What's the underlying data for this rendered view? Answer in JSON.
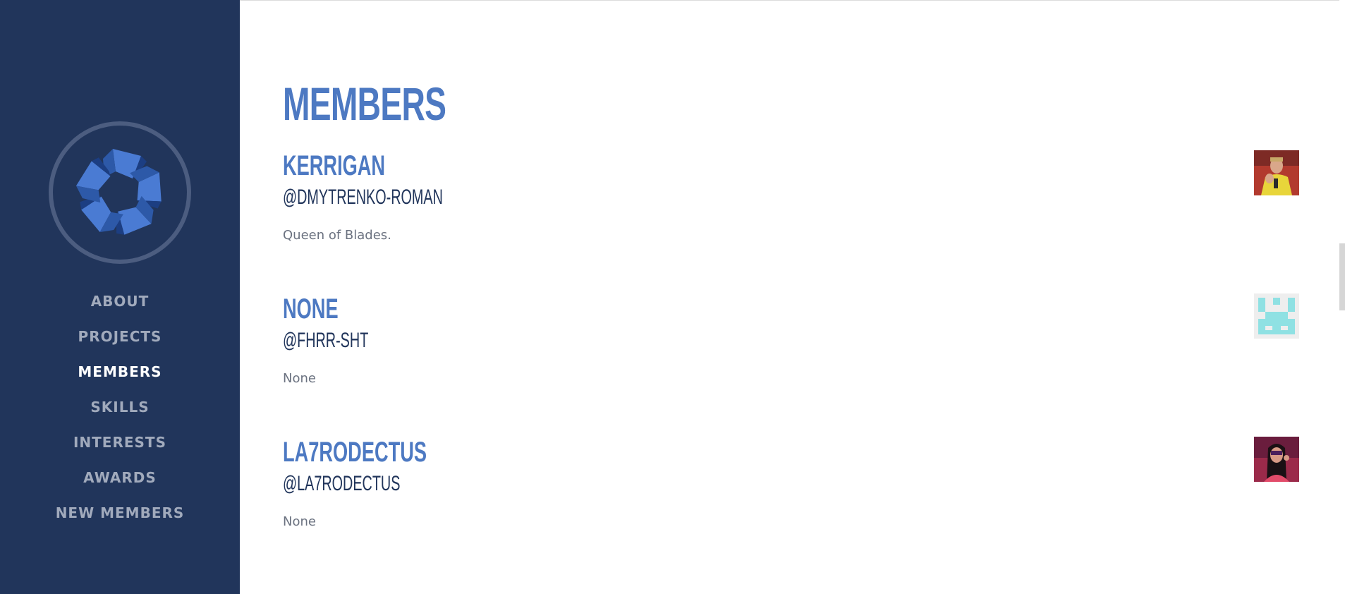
{
  "sidebar": {
    "logo_icon": "pinwheel-logo-icon",
    "nav": [
      {
        "label": "ABOUT",
        "active": false
      },
      {
        "label": "PROJECTS",
        "active": false
      },
      {
        "label": "MEMBERS",
        "active": true
      },
      {
        "label": "SKILLS",
        "active": false
      },
      {
        "label": "INTERESTS",
        "active": false
      },
      {
        "label": "AWARDS",
        "active": false
      },
      {
        "label": "NEW MEMBERS",
        "active": false
      }
    ]
  },
  "main": {
    "title": "MEMBERS",
    "members": [
      {
        "name": "KERRIGAN",
        "handle": "@DMYTRENKO-ROMAN",
        "bio": "Queen of Blades.",
        "avatar_icon": "player-photo-avatar"
      },
      {
        "name": "NONE",
        "handle": "@FHRR-SHT",
        "bio": "None",
        "avatar_icon": "identicon-avatar"
      },
      {
        "name": "LA7RODECTUS",
        "handle": "@LA7RODECTUS",
        "bio": "None",
        "avatar_icon": "portrait-avatar"
      }
    ]
  },
  "colors": {
    "sidebar_bg": "#21355b",
    "accent": "#4d79c2",
    "handle": "#21355b",
    "nav_inactive": "#a1aabc",
    "nav_active": "#ffffff",
    "bio": "#6b7280"
  }
}
